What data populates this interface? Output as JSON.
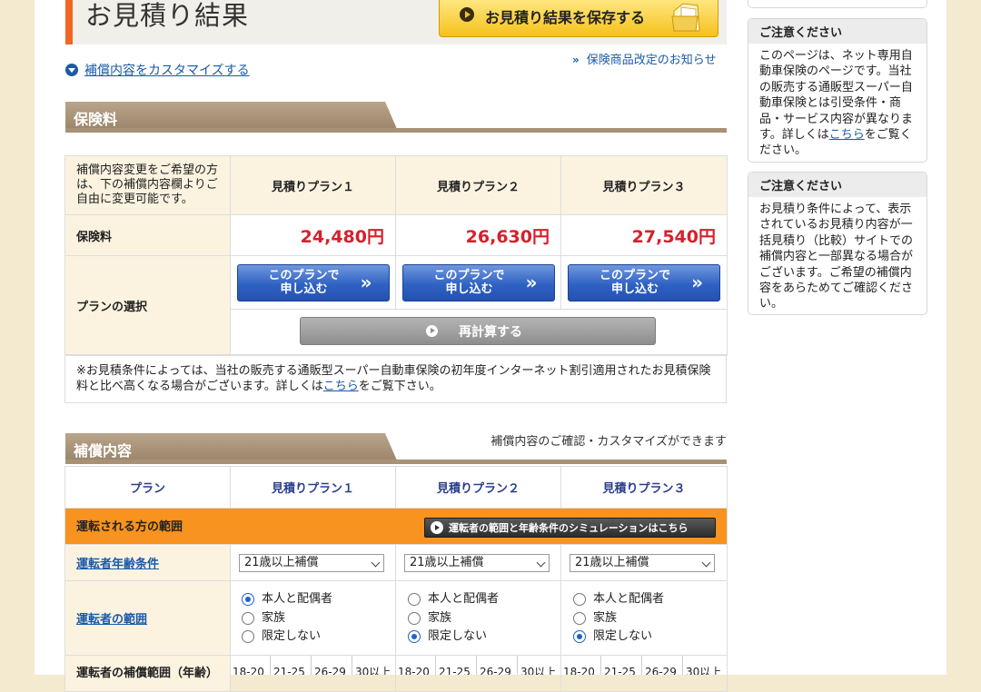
{
  "header": {
    "title": "お見積り結果",
    "save_button": "お見積り結果を保存する"
  },
  "links": {
    "customize": "補償内容をカスタマイズする",
    "product_notice": "保険商品改定のお知らせ"
  },
  "premium": {
    "section_title": "保険料",
    "note": "補償内容変更をご希望の方は、下の補償内容欄よりご自由に変更可能です。",
    "plans": [
      "見積りプラン１",
      "見積りプラン２",
      "見積りプラン３"
    ],
    "row_premium": "保険料",
    "prices": [
      "24,480円",
      "26,630円",
      "27,540円"
    ],
    "row_plan_select": "プランの選択",
    "apply_button": [
      "このプランで",
      "申し込む"
    ],
    "recalc_button": "再計算する",
    "disclaimer_before": "※お見積条件によっては、当社の販売する通販型スーパー自動車保険の初年度インターネット割引適用されたお見積保険料と比べ高くなる場合がございます。詳しくは",
    "disclaimer_link": "こちら",
    "disclaimer_after": "をご覧下さい。"
  },
  "coverage": {
    "section_title": "補償内容",
    "section_sub": "補償内容のご確認・カスタマイズができます",
    "col_plan": "プラン",
    "plans": [
      "見積りプラン１",
      "見積りプラン２",
      "見積りプラン３"
    ],
    "driver_scope_heading": "運転される方の範囲",
    "simulation_button": "運転者の範囲と年齢条件のシミュレーションはこちら",
    "age_condition_label": "運転者年齢条件",
    "age_values": [
      "21歳以上補償",
      "21歳以上補償",
      "21歳以上補償"
    ],
    "driver_range_label": "運転者の範囲",
    "range_options": [
      "本人と配偶者",
      "家族",
      "限定しない"
    ],
    "range_selected": [
      0,
      2,
      2
    ],
    "age_range_label": "運転者の補償範囲（年齢）",
    "age_buckets": [
      "18-20",
      "21-25",
      "26-29",
      "30以上"
    ]
  },
  "sidebar": {
    "box1_title": "ご注意ください",
    "box1_before": "このページは、ネット専用自動車保険のページです。当社の販売する通販型スーパー自動車保険とは引受条件・商品・サービス内容が異なります。詳しくは",
    "box1_link": "こちら",
    "box1_after": "をご覧ください。",
    "box2_title": "ご注意ください",
    "box2_body": "お見積り条件によって、表示されているお見積り内容が一括見積り（比較）サイトでの補償内容と一部異なる場合がございます。ご希望の補償内容をあらためてご確認ください。"
  },
  "colors": {
    "accent_orange": "#f7931e",
    "price_red": "#d6202b",
    "apply_blue": "#2f62c4",
    "link_blue": "#1a5aa8"
  }
}
